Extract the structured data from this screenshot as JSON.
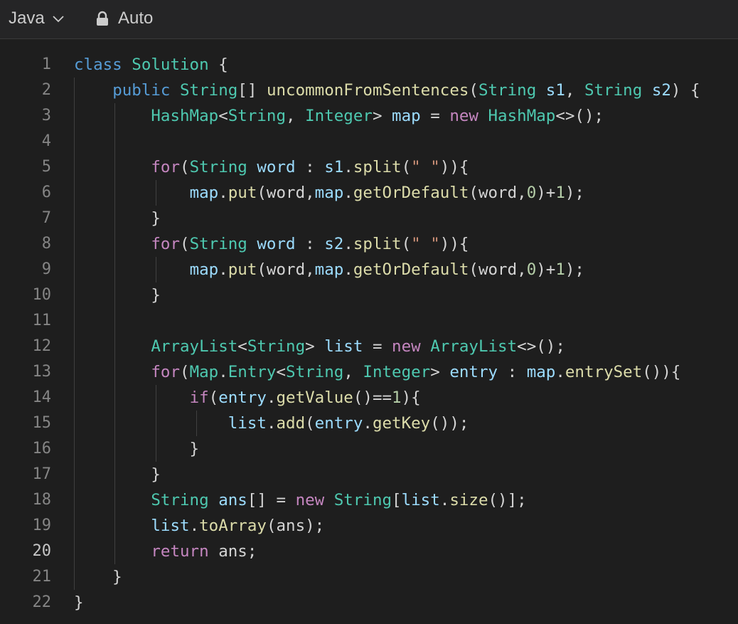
{
  "toolbar": {
    "language_label": "Java",
    "mode_label": "Auto",
    "icons": [
      "chevron-down-icon",
      "lock-icon"
    ]
  },
  "editor": {
    "active_line": 20,
    "line_numbers": [
      "1",
      "2",
      "3",
      "4",
      "5",
      "6",
      "7",
      "8",
      "9",
      "10",
      "11",
      "12",
      "13",
      "14",
      "15",
      "16",
      "17",
      "18",
      "19",
      "20",
      "21",
      "22"
    ],
    "lines": [
      [
        [
          "kw",
          "class"
        ],
        [
          "pl",
          " "
        ],
        [
          "ty",
          "Solution"
        ],
        [
          "pl",
          " {"
        ]
      ],
      [
        [
          "pl",
          "    "
        ],
        [
          "kw",
          "public"
        ],
        [
          "pl",
          " "
        ],
        [
          "ty",
          "String"
        ],
        [
          "pl",
          "[] "
        ],
        [
          "fn",
          "uncommonFromSentences"
        ],
        [
          "pl",
          "("
        ],
        [
          "ty",
          "String"
        ],
        [
          "pl",
          " "
        ],
        [
          "var",
          "s1"
        ],
        [
          "pl",
          ", "
        ],
        [
          "ty",
          "String"
        ],
        [
          "pl",
          " "
        ],
        [
          "var",
          "s2"
        ],
        [
          "pl",
          ") {"
        ]
      ],
      [
        [
          "pl",
          "        "
        ],
        [
          "ty",
          "HashMap"
        ],
        [
          "pl",
          "<"
        ],
        [
          "ty",
          "String"
        ],
        [
          "pl",
          ", "
        ],
        [
          "ty",
          "Integer"
        ],
        [
          "pl",
          "> "
        ],
        [
          "var",
          "map"
        ],
        [
          "pl",
          " = "
        ],
        [
          "ctl",
          "new"
        ],
        [
          "pl",
          " "
        ],
        [
          "ty",
          "HashMap"
        ],
        [
          "pl",
          "<>();"
        ]
      ],
      [],
      [
        [
          "pl",
          "        "
        ],
        [
          "ctl",
          "for"
        ],
        [
          "pl",
          "("
        ],
        [
          "ty",
          "String"
        ],
        [
          "pl",
          " "
        ],
        [
          "var",
          "word"
        ],
        [
          "pl",
          " : "
        ],
        [
          "var",
          "s1"
        ],
        [
          "pl",
          "."
        ],
        [
          "fn",
          "split"
        ],
        [
          "pl",
          "("
        ],
        [
          "str",
          "\" \""
        ],
        [
          "pl",
          ")){"
        ]
      ],
      [
        [
          "pl",
          "            "
        ],
        [
          "var",
          "map"
        ],
        [
          "pl",
          "."
        ],
        [
          "fn",
          "put"
        ],
        [
          "pl",
          "(word,"
        ],
        [
          "var",
          "map"
        ],
        [
          "pl",
          "."
        ],
        [
          "fn",
          "getOrDefault"
        ],
        [
          "pl",
          "(word,"
        ],
        [
          "num",
          "0"
        ],
        [
          "pl",
          ")+"
        ],
        [
          "num",
          "1"
        ],
        [
          "pl",
          ");"
        ]
      ],
      [
        [
          "pl",
          "        }"
        ]
      ],
      [
        [
          "pl",
          "        "
        ],
        [
          "ctl",
          "for"
        ],
        [
          "pl",
          "("
        ],
        [
          "ty",
          "String"
        ],
        [
          "pl",
          " "
        ],
        [
          "var",
          "word"
        ],
        [
          "pl",
          " : "
        ],
        [
          "var",
          "s2"
        ],
        [
          "pl",
          "."
        ],
        [
          "fn",
          "split"
        ],
        [
          "pl",
          "("
        ],
        [
          "str",
          "\" \""
        ],
        [
          "pl",
          ")){"
        ]
      ],
      [
        [
          "pl",
          "            "
        ],
        [
          "var",
          "map"
        ],
        [
          "pl",
          "."
        ],
        [
          "fn",
          "put"
        ],
        [
          "pl",
          "(word,"
        ],
        [
          "var",
          "map"
        ],
        [
          "pl",
          "."
        ],
        [
          "fn",
          "getOrDefault"
        ],
        [
          "pl",
          "(word,"
        ],
        [
          "num",
          "0"
        ],
        [
          "pl",
          ")+"
        ],
        [
          "num",
          "1"
        ],
        [
          "pl",
          ");"
        ]
      ],
      [
        [
          "pl",
          "        }"
        ]
      ],
      [],
      [
        [
          "pl",
          "        "
        ],
        [
          "ty",
          "ArrayList"
        ],
        [
          "pl",
          "<"
        ],
        [
          "ty",
          "String"
        ],
        [
          "pl",
          "> "
        ],
        [
          "var",
          "list"
        ],
        [
          "pl",
          " = "
        ],
        [
          "ctl",
          "new"
        ],
        [
          "pl",
          " "
        ],
        [
          "ty",
          "ArrayList"
        ],
        [
          "pl",
          "<>();"
        ]
      ],
      [
        [
          "pl",
          "        "
        ],
        [
          "ctl",
          "for"
        ],
        [
          "pl",
          "("
        ],
        [
          "ty",
          "Map"
        ],
        [
          "pl",
          "."
        ],
        [
          "ty",
          "Entry"
        ],
        [
          "pl",
          "<"
        ],
        [
          "ty",
          "String"
        ],
        [
          "pl",
          ", "
        ],
        [
          "ty",
          "Integer"
        ],
        [
          "pl",
          "> "
        ],
        [
          "var",
          "entry"
        ],
        [
          "pl",
          " : "
        ],
        [
          "var",
          "map"
        ],
        [
          "pl",
          "."
        ],
        [
          "fn",
          "entrySet"
        ],
        [
          "pl",
          "()){"
        ]
      ],
      [
        [
          "pl",
          "            "
        ],
        [
          "ctl",
          "if"
        ],
        [
          "pl",
          "("
        ],
        [
          "var",
          "entry"
        ],
        [
          "pl",
          "."
        ],
        [
          "fn",
          "getValue"
        ],
        [
          "pl",
          "()=="
        ],
        [
          "num",
          "1"
        ],
        [
          "pl",
          "){"
        ]
      ],
      [
        [
          "pl",
          "                "
        ],
        [
          "var",
          "list"
        ],
        [
          "pl",
          "."
        ],
        [
          "fn",
          "add"
        ],
        [
          "pl",
          "("
        ],
        [
          "var",
          "entry"
        ],
        [
          "pl",
          "."
        ],
        [
          "fn",
          "getKey"
        ],
        [
          "pl",
          "());"
        ]
      ],
      [
        [
          "pl",
          "            }"
        ]
      ],
      [
        [
          "pl",
          "        }"
        ]
      ],
      [
        [
          "pl",
          "        "
        ],
        [
          "ty",
          "String"
        ],
        [
          "pl",
          " "
        ],
        [
          "var",
          "ans"
        ],
        [
          "pl",
          "[] = "
        ],
        [
          "ctl",
          "new"
        ],
        [
          "pl",
          " "
        ],
        [
          "ty",
          "String"
        ],
        [
          "pl",
          "["
        ],
        [
          "var",
          "list"
        ],
        [
          "pl",
          "."
        ],
        [
          "fn",
          "size"
        ],
        [
          "pl",
          "()];"
        ]
      ],
      [
        [
          "pl",
          "        "
        ],
        [
          "var",
          "list"
        ],
        [
          "pl",
          "."
        ],
        [
          "fn",
          "toArray"
        ],
        [
          "pl",
          "(ans);"
        ]
      ],
      [
        [
          "pl",
          "        "
        ],
        [
          "ctl",
          "return"
        ],
        [
          "pl",
          " ans;"
        ]
      ],
      [
        [
          "pl",
          "    }"
        ]
      ],
      [
        [
          "pl",
          "}"
        ]
      ]
    ]
  }
}
